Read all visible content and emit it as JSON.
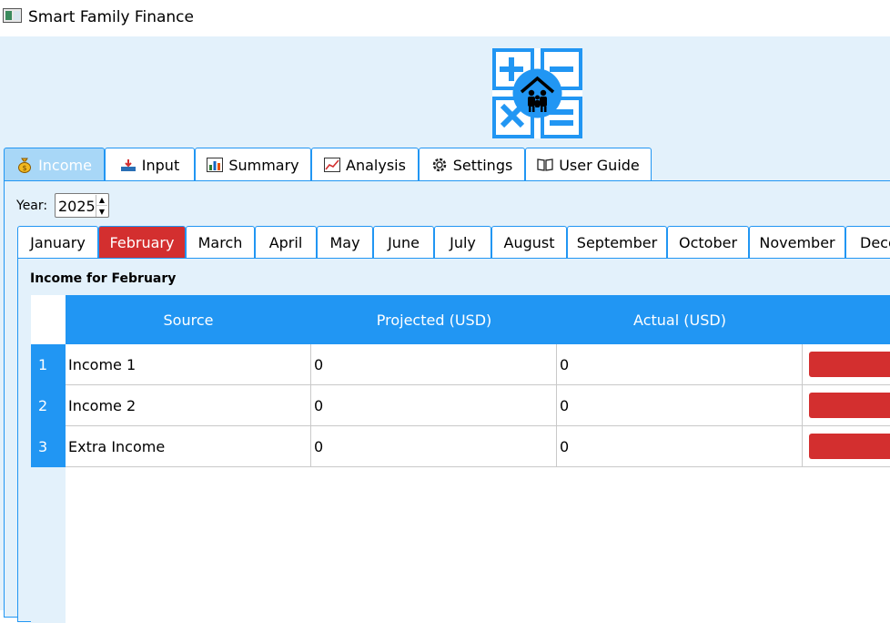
{
  "window": {
    "title": "Smart Family Finance"
  },
  "main_tabs": [
    {
      "label": "Income",
      "icon": "money-bag-icon",
      "active": true
    },
    {
      "label": "Input",
      "icon": "input-tray-icon"
    },
    {
      "label": "Summary",
      "icon": "bar-chart-icon"
    },
    {
      "label": "Analysis",
      "icon": "line-chart-icon"
    },
    {
      "label": "Settings",
      "icon": "gear-icon"
    },
    {
      "label": "User Guide",
      "icon": "book-icon"
    }
  ],
  "year": {
    "label": "Year:",
    "value": "2025"
  },
  "month_tabs": [
    {
      "label": "January"
    },
    {
      "label": "February",
      "active": true
    },
    {
      "label": "March"
    },
    {
      "label": "April"
    },
    {
      "label": "May"
    },
    {
      "label": "June"
    },
    {
      "label": "July"
    },
    {
      "label": "August"
    },
    {
      "label": "September"
    },
    {
      "label": "October"
    },
    {
      "label": "November"
    },
    {
      "label": "Dece"
    }
  ],
  "income": {
    "title": "Income for February",
    "columns": [
      "Source",
      "Projected (USD)",
      "Actual (USD)"
    ],
    "rows": [
      {
        "index": "1",
        "source": "Income 1",
        "projected": "0",
        "actual": "0"
      },
      {
        "index": "2",
        "source": "Income 2",
        "projected": "0",
        "actual": "0"
      },
      {
        "index": "3",
        "source": "Extra Income",
        "projected": "0",
        "actual": "0"
      }
    ]
  },
  "colors": {
    "accent": "#2196f3",
    "active_month": "#d32f2f",
    "background": "#e3f1fb",
    "delete_button": "#d32f2f"
  }
}
